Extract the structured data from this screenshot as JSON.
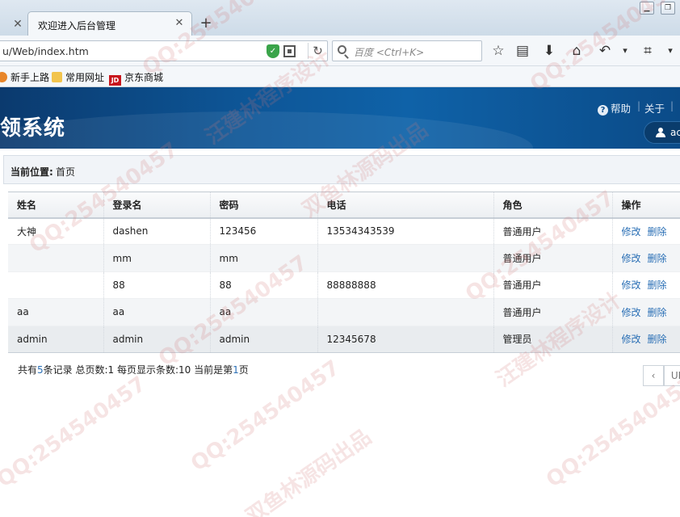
{
  "browser": {
    "tab_title": "欢迎进入后台管理",
    "url": "u/Web/index.htm",
    "search_placeholder": "百度 <Ctrl+K>",
    "bookmarks": [
      "新手上路",
      "常用网址",
      "京东商城"
    ],
    "jd_badge": "JD"
  },
  "header": {
    "title": "领系统",
    "help": "帮助",
    "about": "关于",
    "user": "ac"
  },
  "breadcrumb": {
    "label": "当前位置:",
    "value": "首页"
  },
  "table": {
    "columns": [
      "姓名",
      "登录名",
      "密码",
      "电话",
      "角色",
      "操作"
    ],
    "rows": [
      {
        "name": "大神",
        "login": "dashen",
        "password": "123456",
        "phone": "13534343539",
        "role": "普通用户"
      },
      {
        "name": "",
        "login": "mm",
        "password": "mm",
        "phone": "",
        "role": "普通用户"
      },
      {
        "name": "",
        "login": "88",
        "password": "88",
        "phone": "88888888",
        "role": "普通用户"
      },
      {
        "name": "aa",
        "login": "aa",
        "password": "aa",
        "phone": "",
        "role": "普通用户"
      },
      {
        "name": "admin",
        "login": "admin",
        "password": "admin",
        "phone": "12345678",
        "role": "管理员"
      }
    ],
    "edit_label": "修改",
    "delete_label": "删除"
  },
  "pager": {
    "prefix": "共有",
    "total": "5",
    "suffix": "条记录 总页数:1 每页显示条数:10 当前是第",
    "current": "1",
    "page_suffix": "页",
    "prev_label": "‹",
    "next_label": "UI"
  },
  "watermarks": [
    "QQ:254540457",
    "汪建林程序设计",
    "双鱼林源码出品"
  ],
  "colors": {
    "header_blue": "#0d5596",
    "link_blue": "#2a6fb5"
  }
}
